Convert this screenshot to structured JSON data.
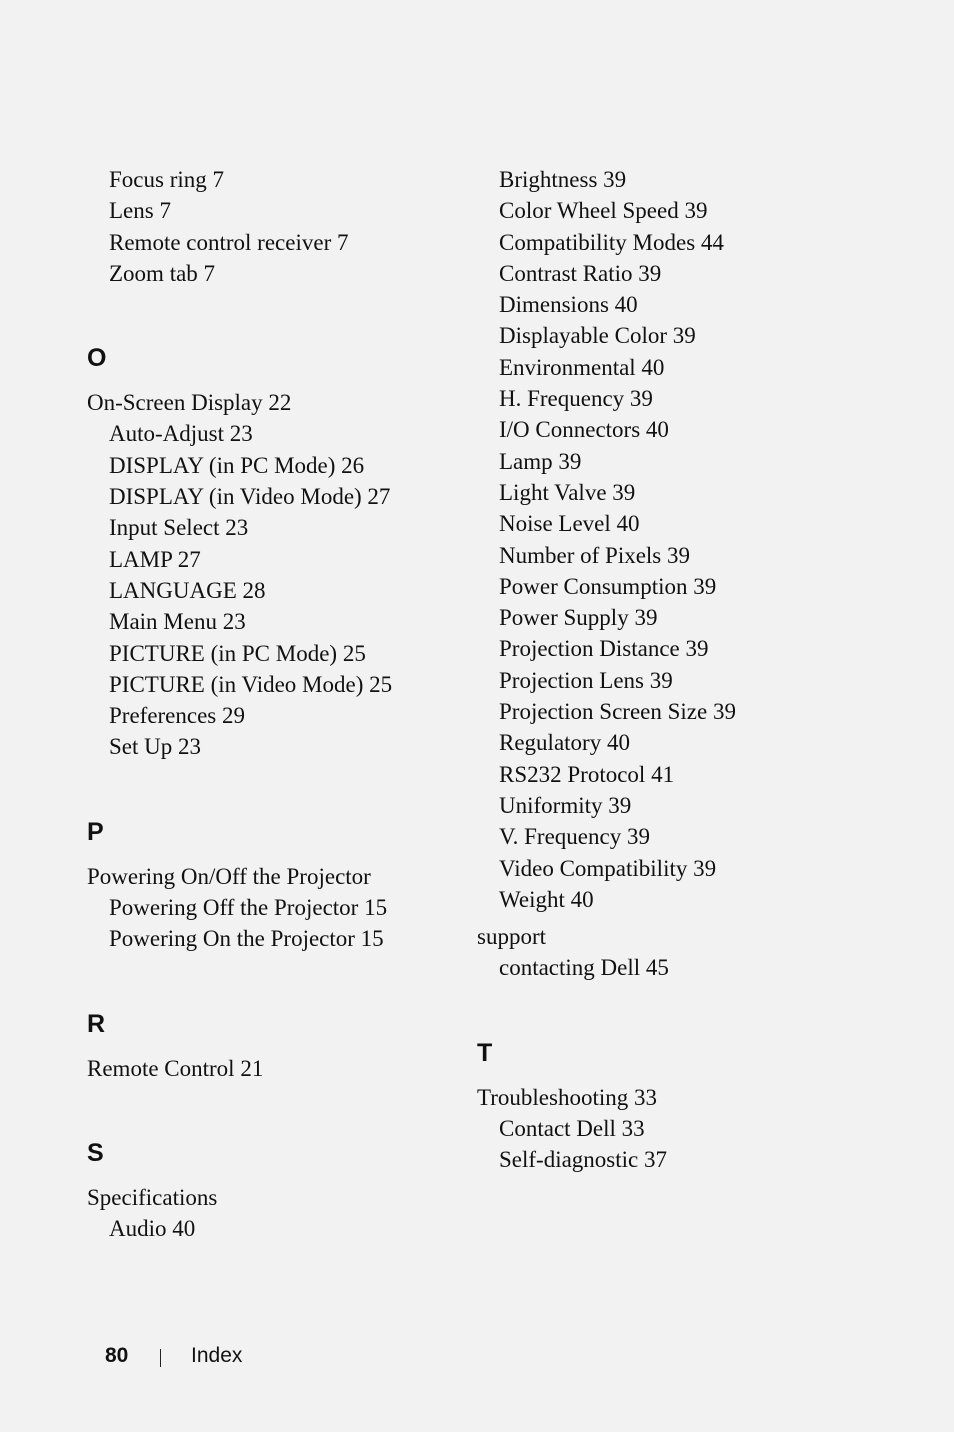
{
  "left_column": [
    {
      "text": "Focus ring 7",
      "level": 1
    },
    {
      "text": "Lens 7",
      "level": 1
    },
    {
      "text": "Remote control receiver 7",
      "level": 1
    },
    {
      "text": "Zoom tab 7",
      "level": 1
    },
    {
      "letter": "O"
    },
    {
      "text": "On-Screen Display 22",
      "level": 0
    },
    {
      "text": "Auto-Adjust 23",
      "level": 1
    },
    {
      "text": "DISPLAY (in PC Mode) 26",
      "level": 1
    },
    {
      "text": "DISPLAY (in Video Mode) 27",
      "level": 1
    },
    {
      "text": "Input Select 23",
      "level": 1
    },
    {
      "text": "LAMP 27",
      "level": 1
    },
    {
      "text": "LANGUAGE 28",
      "level": 1
    },
    {
      "text": "Main Menu 23",
      "level": 1
    },
    {
      "text": "PICTURE (in PC Mode) 25",
      "level": 1
    },
    {
      "text": "PICTURE (in Video Mode) 25",
      "level": 1
    },
    {
      "text": "Preferences 29",
      "level": 1
    },
    {
      "text": "Set Up 23",
      "level": 1
    },
    {
      "letter": "P"
    },
    {
      "text": "Powering On/Off the Projector",
      "level": 0
    },
    {
      "text": "Powering Off the Projector 15",
      "level": 1
    },
    {
      "text": "Powering On the Projector 15",
      "level": 1
    },
    {
      "letter": "R"
    },
    {
      "text": "Remote Control 21",
      "level": 0
    },
    {
      "letter": "S"
    },
    {
      "text": "Specifications",
      "level": 0
    },
    {
      "text": "Audio 40",
      "level": 1
    }
  ],
  "right_column": [
    {
      "text": "Brightness 39",
      "level": 1
    },
    {
      "text": "Color Wheel Speed 39",
      "level": 1
    },
    {
      "text": "Compatibility Modes 44",
      "level": 1
    },
    {
      "text": "Contrast Ratio 39",
      "level": 1
    },
    {
      "text": "Dimensions 40",
      "level": 1
    },
    {
      "text": "Displayable Color 39",
      "level": 1
    },
    {
      "text": "Environmental 40",
      "level": 1
    },
    {
      "text": "H. Frequency 39",
      "level": 1
    },
    {
      "text": "I/O Connectors 40",
      "level": 1
    },
    {
      "text": "Lamp 39",
      "level": 1
    },
    {
      "text": "Light Valve 39",
      "level": 1
    },
    {
      "text": "Noise Level 40",
      "level": 1
    },
    {
      "text": "Number of Pixels 39",
      "level": 1
    },
    {
      "text": "Power Consumption 39",
      "level": 1
    },
    {
      "text": "Power Supply 39",
      "level": 1
    },
    {
      "text": "Projection Distance 39",
      "level": 1
    },
    {
      "text": "Projection Lens 39",
      "level": 1
    },
    {
      "text": "Projection Screen Size 39",
      "level": 1
    },
    {
      "text": "Regulatory 40",
      "level": 1
    },
    {
      "text": "RS232 Protocol 41",
      "level": 1
    },
    {
      "text": "Uniformity 39",
      "level": 1
    },
    {
      "text": "V. Frequency 39",
      "level": 1
    },
    {
      "text": "Video Compatibility 39",
      "level": 1
    },
    {
      "text": "Weight 40",
      "level": 1
    },
    {
      "gap": true
    },
    {
      "text": "support",
      "level": 0
    },
    {
      "text": "contacting Dell 45",
      "level": 1
    },
    {
      "letter": "T"
    },
    {
      "text": "Troubleshooting 33",
      "level": 0
    },
    {
      "text": "Contact Dell 33",
      "level": 1
    },
    {
      "text": "Self-diagnostic 37",
      "level": 1
    }
  ],
  "footer": {
    "page_number": "80",
    "section": "Index"
  }
}
